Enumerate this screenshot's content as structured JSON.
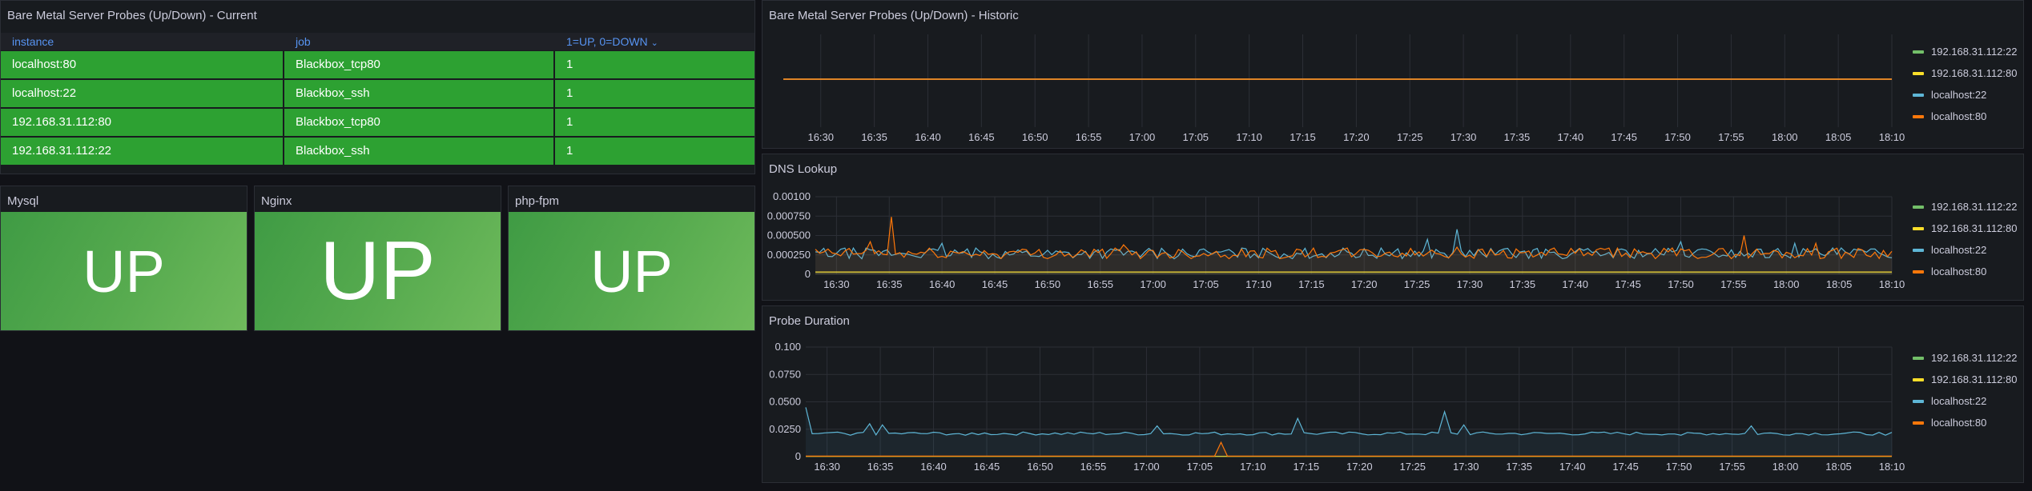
{
  "colors": {
    "green": "#73bf69",
    "yellow": "#fade2a",
    "blue": "#5eb6d6",
    "orange": "#ff780a",
    "cell_green": "#2da132"
  },
  "probes_current": {
    "title": "Bare Metal Server Probes (Up/Down) - Current",
    "columns": [
      "instance",
      "job",
      "1=UP, 0=DOWN"
    ],
    "sort_icon": "chevron-down-icon",
    "rows": [
      {
        "instance": "localhost:80",
        "job": "Blackbox_tcp80",
        "value": "1"
      },
      {
        "instance": "localhost:22",
        "job": "Blackbox_ssh",
        "value": "1"
      },
      {
        "instance": "192.168.31.112:80",
        "job": "Blackbox_tcp80",
        "value": "1"
      },
      {
        "instance": "192.168.31.112:22",
        "job": "Blackbox_ssh",
        "value": "1"
      }
    ]
  },
  "stats": [
    {
      "title": "Mysql",
      "value": "UP"
    },
    {
      "title": "Nginx",
      "value": "UP"
    },
    {
      "title": "php-fpm",
      "value": "UP"
    }
  ],
  "legend": [
    "192.168.31.112:22",
    "192.168.31.112:80",
    "localhost:22",
    "localhost:80"
  ],
  "charts": {
    "historic": {
      "title": "Bare Metal Server Probes (Up/Down) - Historic",
      "x_ticks": [
        "16:30",
        "16:35",
        "16:40",
        "16:45",
        "16:50",
        "16:55",
        "17:00",
        "17:05",
        "17:10",
        "17:15",
        "17:20",
        "17:25",
        "17:30",
        "17:35",
        "17:40",
        "17:45",
        "17:50",
        "17:55",
        "18:00",
        "18:05",
        "18:10"
      ]
    },
    "dns": {
      "title": "DNS Lookup",
      "y_ticks": [
        "0.00100",
        "0.000750",
        "0.000500",
        "0.000250",
        "0"
      ],
      "x_ticks": [
        "16:30",
        "16:35",
        "16:40",
        "16:45",
        "16:50",
        "16:55",
        "17:00",
        "17:05",
        "17:10",
        "17:15",
        "17:20",
        "17:25",
        "17:30",
        "17:35",
        "17:40",
        "17:45",
        "17:50",
        "17:55",
        "18:00",
        "18:05",
        "18:10"
      ]
    },
    "duration": {
      "title": "Probe Duration",
      "y_ticks": [
        "0.100",
        "0.0750",
        "0.0500",
        "0.0250",
        "0"
      ],
      "x_ticks": [
        "16:30",
        "16:35",
        "16:40",
        "16:45",
        "16:50",
        "16:55",
        "17:00",
        "17:05",
        "17:10",
        "17:15",
        "17:20",
        "17:25",
        "17:30",
        "17:35",
        "17:40",
        "17:45",
        "17:50",
        "17:55",
        "18:00",
        "18:05",
        "18:10"
      ]
    }
  },
  "chart_data": [
    {
      "type": "line",
      "title": "Bare Metal Server Probes (Up/Down) - Historic",
      "x_range": [
        "16:28",
        "18:10"
      ],
      "grid": true,
      "legend_position": "right",
      "series": [
        {
          "name": "192.168.31.112:22",
          "color": "#73bf69",
          "value": 1
        },
        {
          "name": "192.168.31.112:80",
          "color": "#fade2a",
          "value": 1
        },
        {
          "name": "localhost:22",
          "color": "#5eb6d6",
          "value": 1
        },
        {
          "name": "localhost:80",
          "color": "#ff780a",
          "value": 1
        }
      ]
    },
    {
      "type": "line",
      "title": "DNS Lookup",
      "ylim": [
        0,
        0.001
      ],
      "grid": true,
      "legend_position": "right",
      "series": [
        {
          "name": "192.168.31.112:22",
          "color": "#73bf69",
          "baseline": 3e-05
        },
        {
          "name": "192.168.31.112:80",
          "color": "#fade2a",
          "baseline": 3e-05
        },
        {
          "name": "localhost:22",
          "color": "#5eb6d6",
          "baseline": 0.00027,
          "noise": 7e-05,
          "spikes": [
            [
              "16:40",
              0.0004
            ],
            [
              "17:26",
              0.00045
            ],
            [
              "17:29",
              0.00058
            ],
            [
              "17:50",
              0.00042
            ],
            [
              "18:01",
              0.0004
            ]
          ]
        },
        {
          "name": "localhost:80",
          "color": "#ff780a",
          "baseline": 0.00027,
          "noise": 7e-05,
          "spikes": [
            [
              "16:33",
              0.00042
            ],
            [
              "16:35",
              0.00074
            ],
            [
              "16:57",
              0.00038
            ],
            [
              "17:29",
              0.00035
            ],
            [
              "17:56",
              0.0005
            ],
            [
              "18:03",
              0.0004
            ]
          ]
        }
      ]
    },
    {
      "type": "line",
      "title": "Probe Duration",
      "ylim": [
        0,
        0.1
      ],
      "grid": true,
      "legend_position": "right",
      "series": [
        {
          "name": "192.168.31.112:22",
          "color": "#73bf69",
          "baseline": 0.0002
        },
        {
          "name": "192.168.31.112:80",
          "color": "#fade2a",
          "baseline": 0.0002
        },
        {
          "name": "localhost:22",
          "color": "#5eb6d6",
          "baseline": 0.021,
          "noise": 0.0015,
          "spikes": [
            [
              "16:28",
              0.045
            ],
            [
              "16:34",
              0.03
            ],
            [
              "16:35",
              0.029
            ],
            [
              "17:01",
              0.028
            ],
            [
              "17:14",
              0.035
            ],
            [
              "17:28",
              0.041
            ],
            [
              "17:30",
              0.029
            ],
            [
              "17:57",
              0.028
            ]
          ]
        },
        {
          "name": "localhost:80",
          "color": "#ff780a",
          "baseline": 0.0005,
          "spikes": [
            [
              "17:07",
              0.013
            ]
          ]
        }
      ]
    }
  ]
}
